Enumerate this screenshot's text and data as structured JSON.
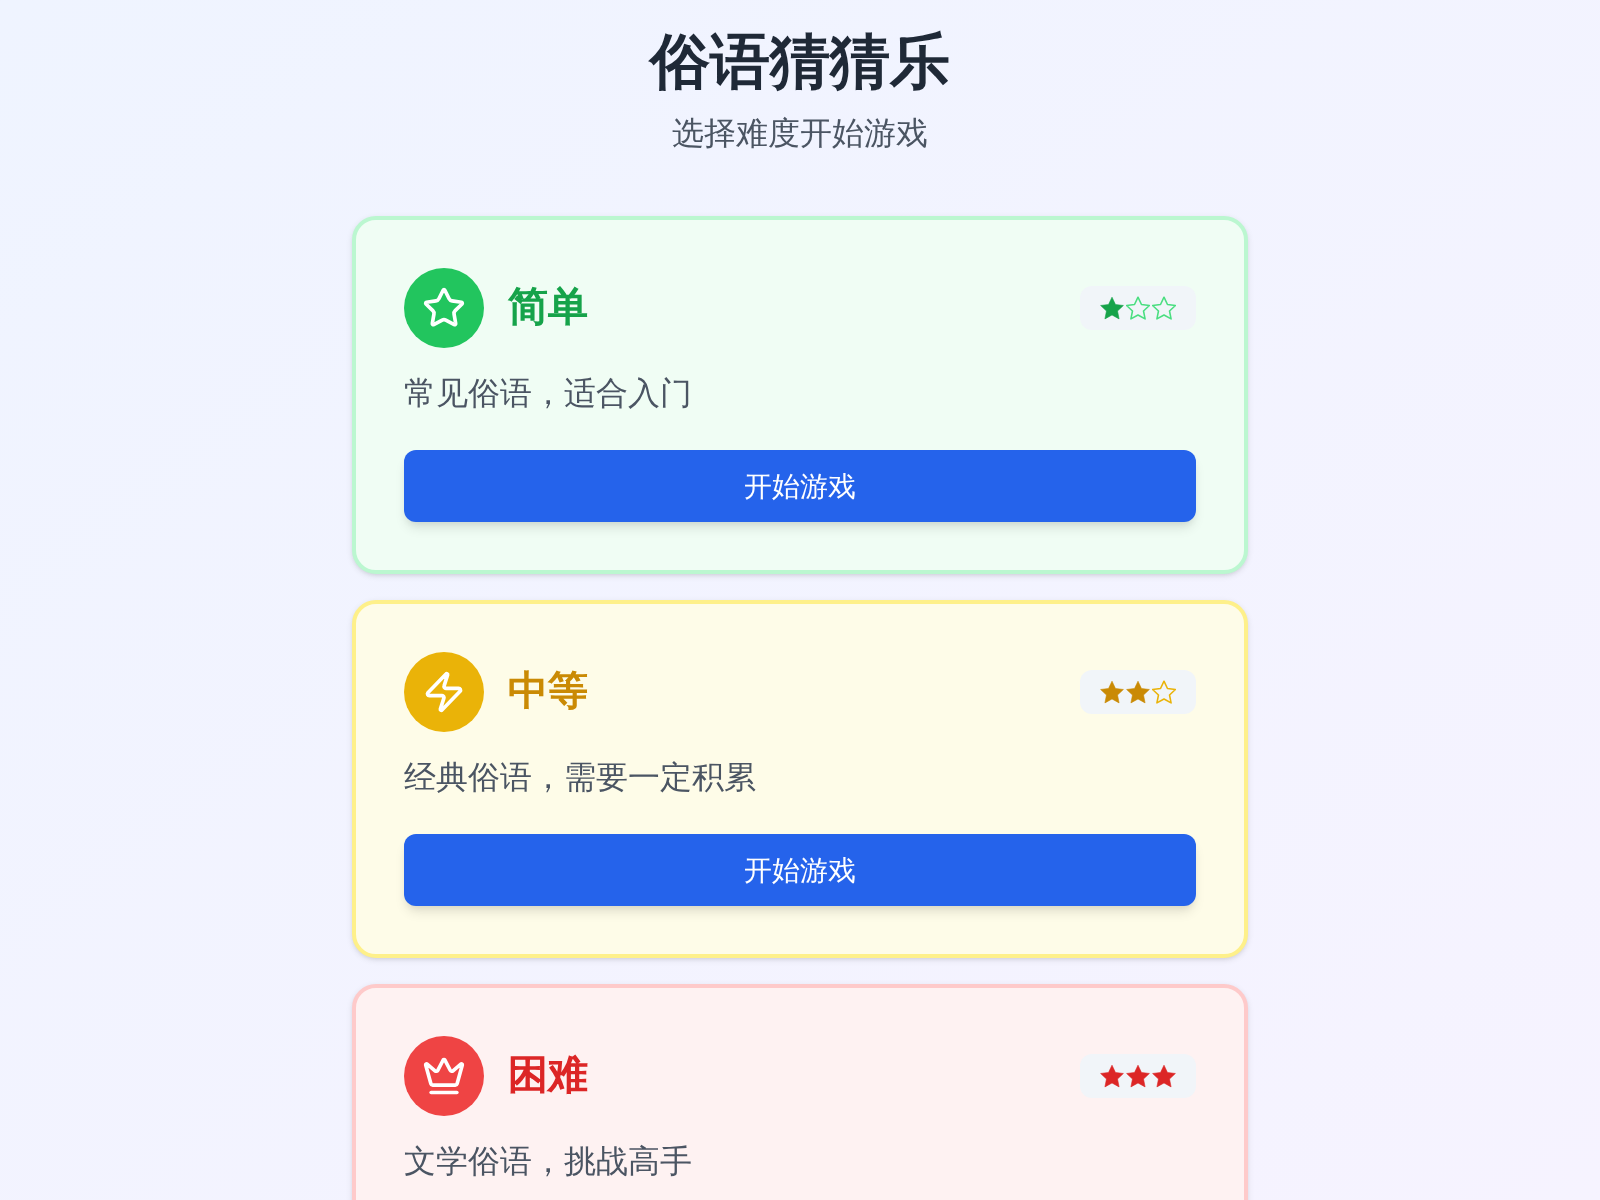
{
  "header": {
    "title": "俗语猜猜乐",
    "subtitle": "选择难度开始游戏"
  },
  "levels": [
    {
      "kind": "easy",
      "title": "简单",
      "stars": 1,
      "description": "常见俗语，适合入门",
      "button": "开始游戏"
    },
    {
      "kind": "medium",
      "title": "中等",
      "stars": 2,
      "description": "经典俗语，需要一定积累",
      "button": "开始游戏"
    },
    {
      "kind": "hard",
      "title": "困难",
      "stars": 3,
      "description": "文学俗语，挑战高手"
    }
  ]
}
